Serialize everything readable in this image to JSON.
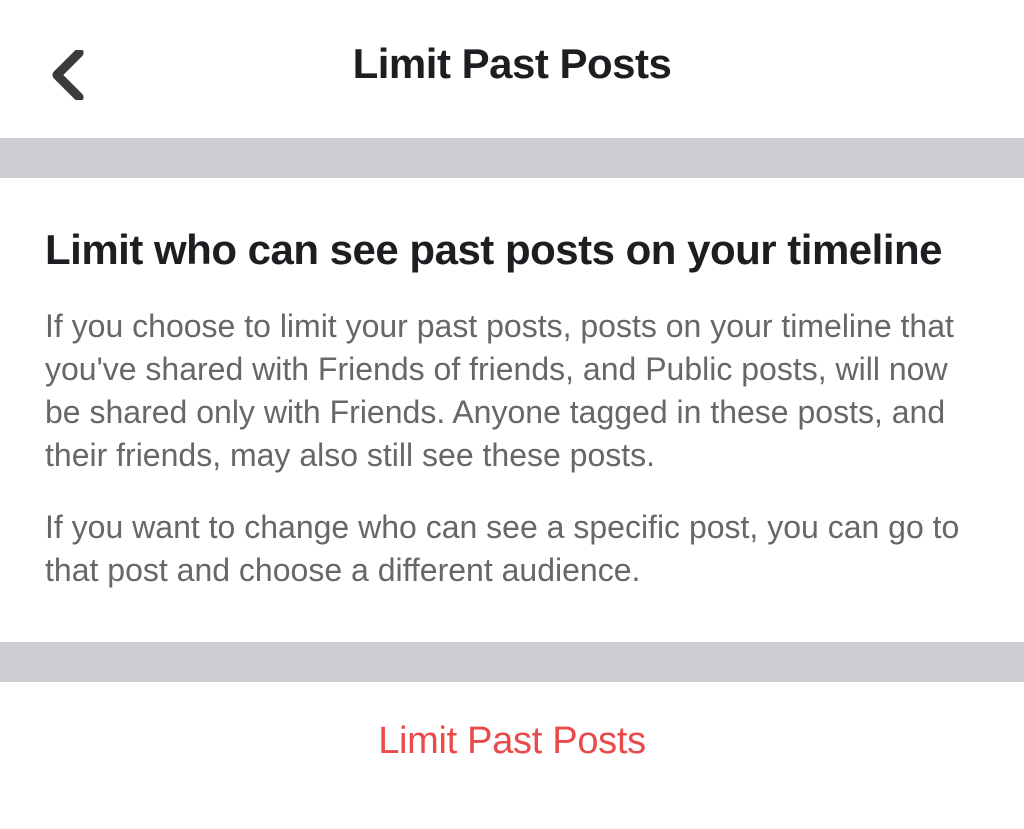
{
  "header": {
    "title": "Limit Past Posts"
  },
  "content": {
    "heading": "Limit who can see past posts on your timeline",
    "paragraph1": "If you choose to limit your past posts, posts on your timeline that you've shared with Friends of friends, and Public posts, will now be shared only with Friends. Anyone tagged in these posts, and their friends, may also still see these posts.",
    "paragraph2": "If you want to change who can see a specific post, you can go to that post and choose a different audience."
  },
  "action": {
    "label": "Limit Past Posts"
  }
}
